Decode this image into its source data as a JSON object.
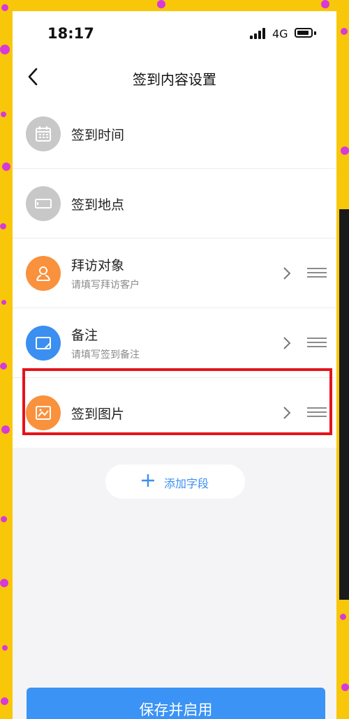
{
  "status_bar": {
    "time": "18:17",
    "network": "4G"
  },
  "nav": {
    "title": "签到内容设置"
  },
  "fields": [
    {
      "title": "签到时间",
      "icon": "calendar-icon",
      "color": "#c8c8c8"
    },
    {
      "title": "签到地点",
      "icon": "location-card-icon",
      "color": "#c8c8c8"
    },
    {
      "title": "拜访对象",
      "subtitle": "请填写拜访客户",
      "icon": "person-icon",
      "color": "#f9913d"
    },
    {
      "title": "备注",
      "subtitle": "请填写签到备注",
      "icon": "note-icon",
      "color": "#3a8ff0"
    },
    {
      "title": "签到图片",
      "icon": "image-icon",
      "color": "#f9913d"
    }
  ],
  "add_field": {
    "label": "添加字段"
  },
  "save": {
    "label": "保存并启用"
  },
  "colors": {
    "accent": "#3a93f5",
    "highlight": "#e4141b",
    "background": "#f9c70a"
  }
}
